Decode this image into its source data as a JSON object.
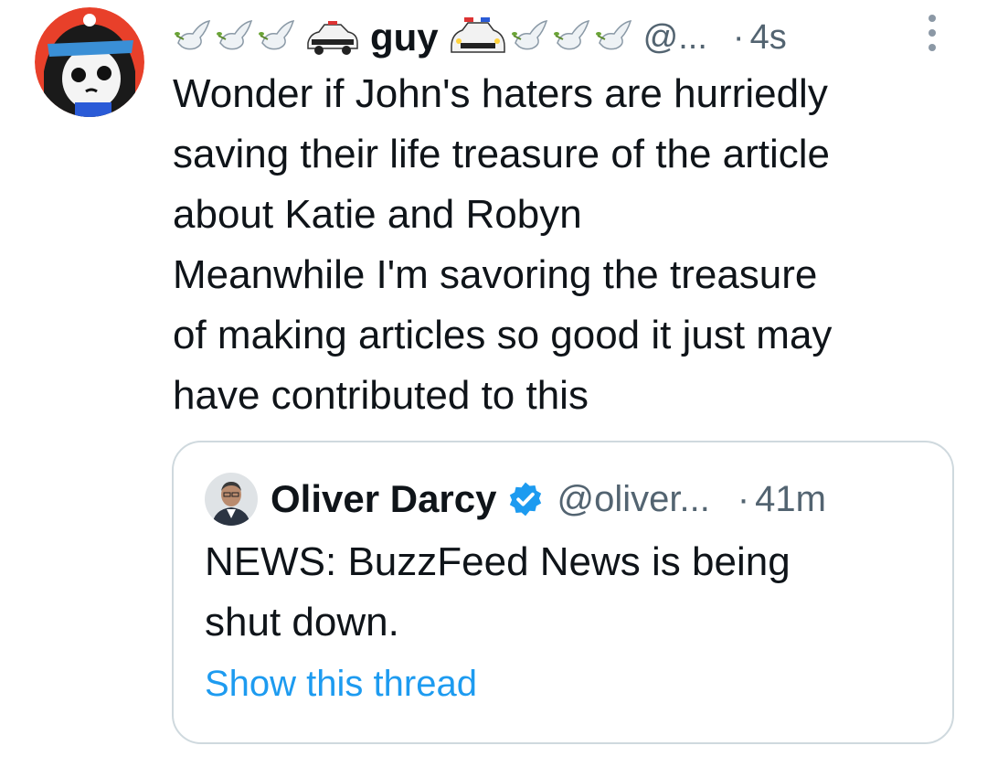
{
  "tweet": {
    "display_name": "guy",
    "handle": "@...",
    "separator": "·",
    "time": "4s",
    "name_emojis_left": [
      "dove-of-peace",
      "dove-of-peace",
      "dove-of-peace",
      "police-car"
    ],
    "name_emojis_right": [
      "police-car",
      "dove-of-peace",
      "dove-of-peace",
      "dove-of-peace"
    ],
    "text": "Wonder if John's haters are hurriedly\nsaving their life treasure of the article\nabout Katie and Robyn\nMeanwhile I'm savoring the treasure\nof making articles so good it just may\nhave contributed to this"
  },
  "quote": {
    "display_name": "Oliver Darcy",
    "handle": "@oliver...",
    "separator": "·",
    "time": "41m",
    "text": "NEWS: BuzzFeed News is being\nshut down.",
    "show_thread_label": "Show this thread",
    "verified": true
  },
  "colors": {
    "text": "#0f1419",
    "secondary": "#536471",
    "link": "#1d9bf0",
    "border": "#cfd9de"
  }
}
